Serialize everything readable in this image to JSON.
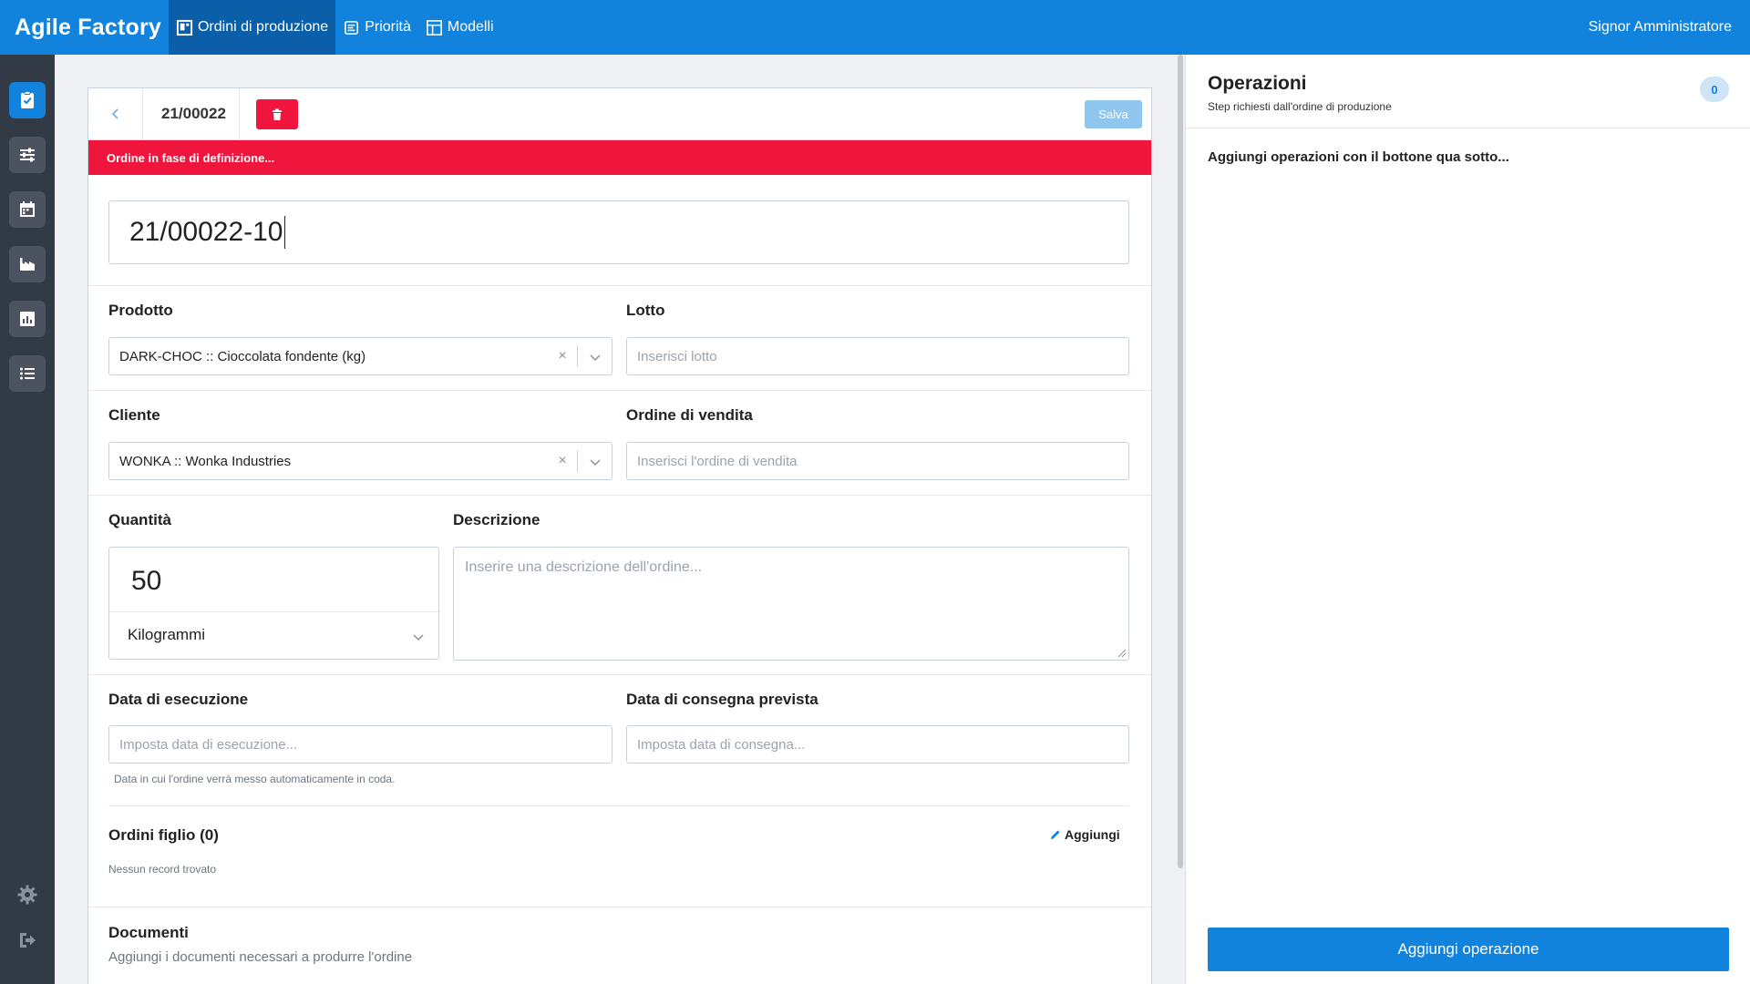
{
  "app": {
    "title": "Agile Factory",
    "user": "Signor Amministratore"
  },
  "nav": [
    {
      "label": "Ordini di produzione",
      "icon": "production-orders-icon",
      "active": true
    },
    {
      "label": "Priorità",
      "icon": "priority-icon",
      "active": false
    },
    {
      "label": "Modelli",
      "icon": "models-icon",
      "active": false
    }
  ],
  "sidebar": {
    "items": [
      "orders-check-icon",
      "priority-sliders-icon",
      "calendar-icon",
      "factory-icon",
      "chart-icon",
      "list-icon"
    ],
    "bottom": [
      "gear-icon",
      "logout-icon"
    ]
  },
  "order": {
    "code": "21/00022",
    "save_label": "Salva",
    "status_banner": "Ordine in fase di definizione...",
    "name_value": "21/00022-10"
  },
  "form": {
    "product": {
      "label": "Prodotto",
      "value": "DARK-CHOC :: Cioccolata fondente (kg)"
    },
    "lot": {
      "label": "Lotto",
      "placeholder": "Inserisci lotto"
    },
    "customer": {
      "label": "Cliente",
      "value": "WONKA :: Wonka Industries"
    },
    "sales_order": {
      "label": "Ordine di vendita",
      "placeholder": "Inserisci l'ordine di vendita"
    },
    "quantity": {
      "label": "Quantità",
      "value": "50",
      "unit": "Kilogrammi"
    },
    "description": {
      "label": "Descrizione",
      "placeholder": "Inserire una descrizione dell'ordine..."
    },
    "exec_date": {
      "label": "Data di esecuzione",
      "placeholder": "Imposta data di esecuzione...",
      "hint": "Data in cui l'ordine verrà messo automaticamente in coda."
    },
    "delivery_date": {
      "label": "Data di consegna prevista",
      "placeholder": "Imposta data di consegna..."
    },
    "child_orders": {
      "label": "Ordini figlio (0)",
      "add_label": "Aggiungi",
      "empty": "Nessun record trovato"
    },
    "documents": {
      "label": "Documenti",
      "subtitle": "Aggiungi i documenti necessari a produrre l'ordine"
    }
  },
  "operations": {
    "title": "Operazioni",
    "subtitle": "Step richiesti dall'ordine di produzione",
    "count": "0",
    "empty_message": "Aggiungi operazioni con il bottone qua sotto...",
    "add_button": "Aggiungi operazione"
  },
  "colors": {
    "primary": "#1283dc",
    "danger": "#f0153d",
    "sidebar": "#323a45"
  }
}
